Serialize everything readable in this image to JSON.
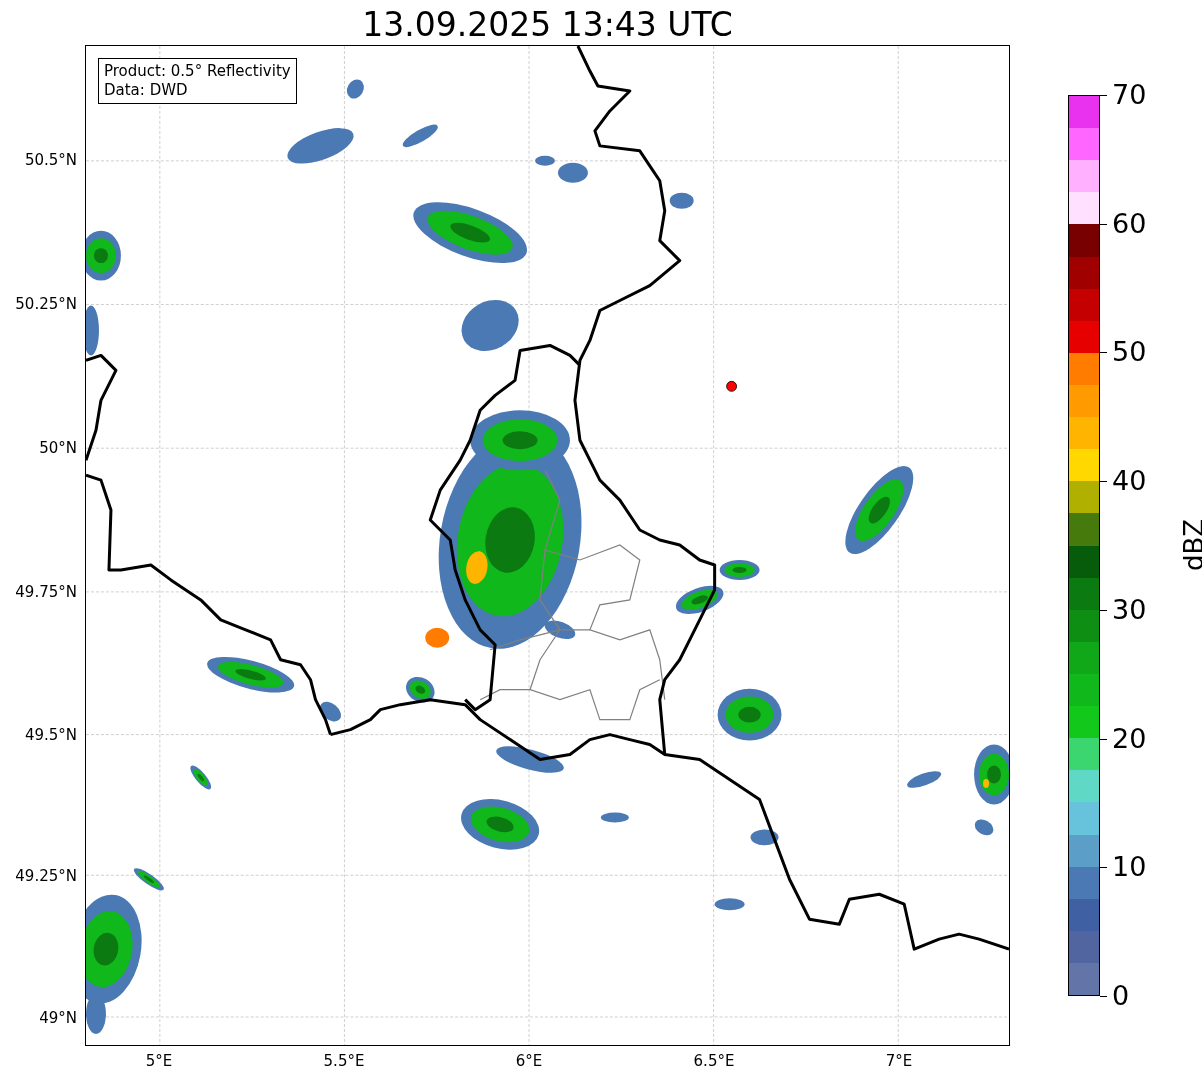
{
  "title": "13.09.2025 13:43 UTC",
  "legend": {
    "lines": [
      "Product: 0.5° Reflectivity",
      "Data: DWD"
    ]
  },
  "axes": {
    "xticks": [
      "5°E",
      "5.5°E",
      "6°E",
      "6.5°E",
      "7°E"
    ],
    "yticks": [
      "50.5°N",
      "50.25°N",
      "50°N",
      "49.75°N",
      "49.5°N",
      "49.25°N",
      "49°N"
    ]
  },
  "colorbar": {
    "label": "dBZ",
    "ticks": [
      "70",
      "60",
      "50",
      "40",
      "30",
      "20",
      "10",
      "0"
    ],
    "bands": [
      {
        "color": "#6374a8"
      },
      {
        "color": "#5166a0"
      },
      {
        "color": "#4060a4"
      },
      {
        "color": "#4a79b3"
      },
      {
        "color": "#5b9ec8"
      },
      {
        "color": "#67c2dc"
      },
      {
        "color": "#60d8c6"
      },
      {
        "color": "#3cd670"
      },
      {
        "color": "#12c81a"
      },
      {
        "color": "#10b81c"
      },
      {
        "color": "#10a818"
      },
      {
        "color": "#0e8f14"
      },
      {
        "color": "#0b7a10"
      },
      {
        "color": "#075c0b"
      },
      {
        "color": "#467a0c"
      },
      {
        "color": "#b0b000"
      },
      {
        "color": "#ffd800"
      },
      {
        "color": "#ffb400"
      },
      {
        "color": "#ff9a00"
      },
      {
        "color": "#ff7c00"
      },
      {
        "color": "#e60000"
      },
      {
        "color": "#c40000"
      },
      {
        "color": "#a00000"
      },
      {
        "color": "#780000"
      },
      {
        "color": "#ffe0ff"
      },
      {
        "color": "#ffb0ff"
      },
      {
        "color": "#ff66ff"
      },
      {
        "color": "#e832f0"
      }
    ]
  }
}
